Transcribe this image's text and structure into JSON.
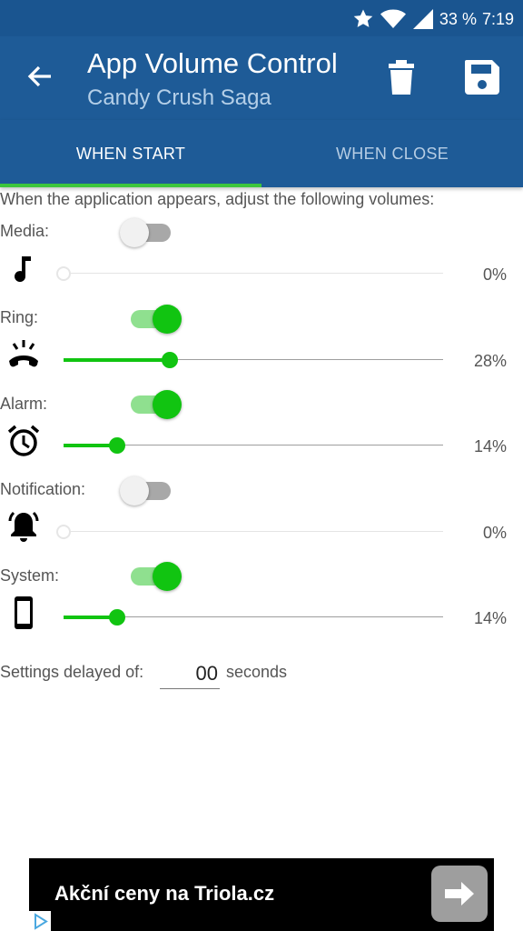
{
  "status_bar": {
    "battery": "33 %",
    "time": "7:19",
    "icons": [
      "star-icon",
      "wifi-icon",
      "signal-icon"
    ]
  },
  "app_bar": {
    "title": "App Volume Control",
    "subtitle": "Candy Crush Saga",
    "icons": [
      "back-arrow-icon",
      "trash-icon",
      "save-icon"
    ]
  },
  "tabs": [
    {
      "label": "WHEN START",
      "active": true
    },
    {
      "label": "WHEN CLOSE",
      "active": false
    }
  ],
  "intro": "When the application appears, adjust the following volumes:",
  "volumes": [
    {
      "label": "Media:",
      "enabled": false,
      "percent": "0%",
      "level": 0,
      "icon": "music-note-icon"
    },
    {
      "label": "Ring:",
      "enabled": true,
      "percent": "28%",
      "level": 0.28,
      "icon": "ringing-phone-icon"
    },
    {
      "label": "Alarm:",
      "enabled": true,
      "percent": "14%",
      "level": 0.14,
      "icon": "alarm-clock-icon"
    },
    {
      "label": "Notification:",
      "enabled": false,
      "percent": "0%",
      "level": 0,
      "icon": "bell-icon"
    },
    {
      "label": "System:",
      "enabled": true,
      "percent": "14%",
      "level": 0.14,
      "icon": "smartphone-icon"
    }
  ],
  "delay": {
    "label": "Settings delayed of:",
    "value": "00",
    "unit": "seconds"
  },
  "ad": {
    "text": "Akční ceny na Triola.cz",
    "icons": [
      "arrow-right-icon",
      "ad-choices-icon"
    ]
  },
  "colors": {
    "app_bar": "#1e5b97",
    "status_bar": "#1a5590",
    "accent_green": "#11c411",
    "tab_indicator": "#3cc63c"
  }
}
